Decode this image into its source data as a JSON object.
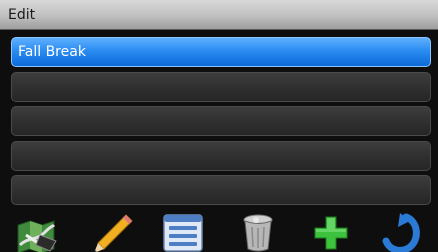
{
  "title": "Edit",
  "list": {
    "rows": [
      "Fall Break",
      "",
      "",
      "",
      ""
    ],
    "selected_index": 0
  },
  "toolbar": {
    "buttons": [
      {
        "icon": "map-route-icon"
      },
      {
        "icon": "pencil-icon"
      },
      {
        "icon": "list-details-icon"
      },
      {
        "icon": "trash-can-icon"
      },
      {
        "icon": "add-plus-icon"
      },
      {
        "icon": "back-arrow-icon"
      }
    ]
  },
  "colors": {
    "selection": "#1a7ce6",
    "titlebar": "#c4c4c4",
    "row": "#303030",
    "plus": "#3cc23c",
    "back_arrow": "#2a7ad6"
  }
}
